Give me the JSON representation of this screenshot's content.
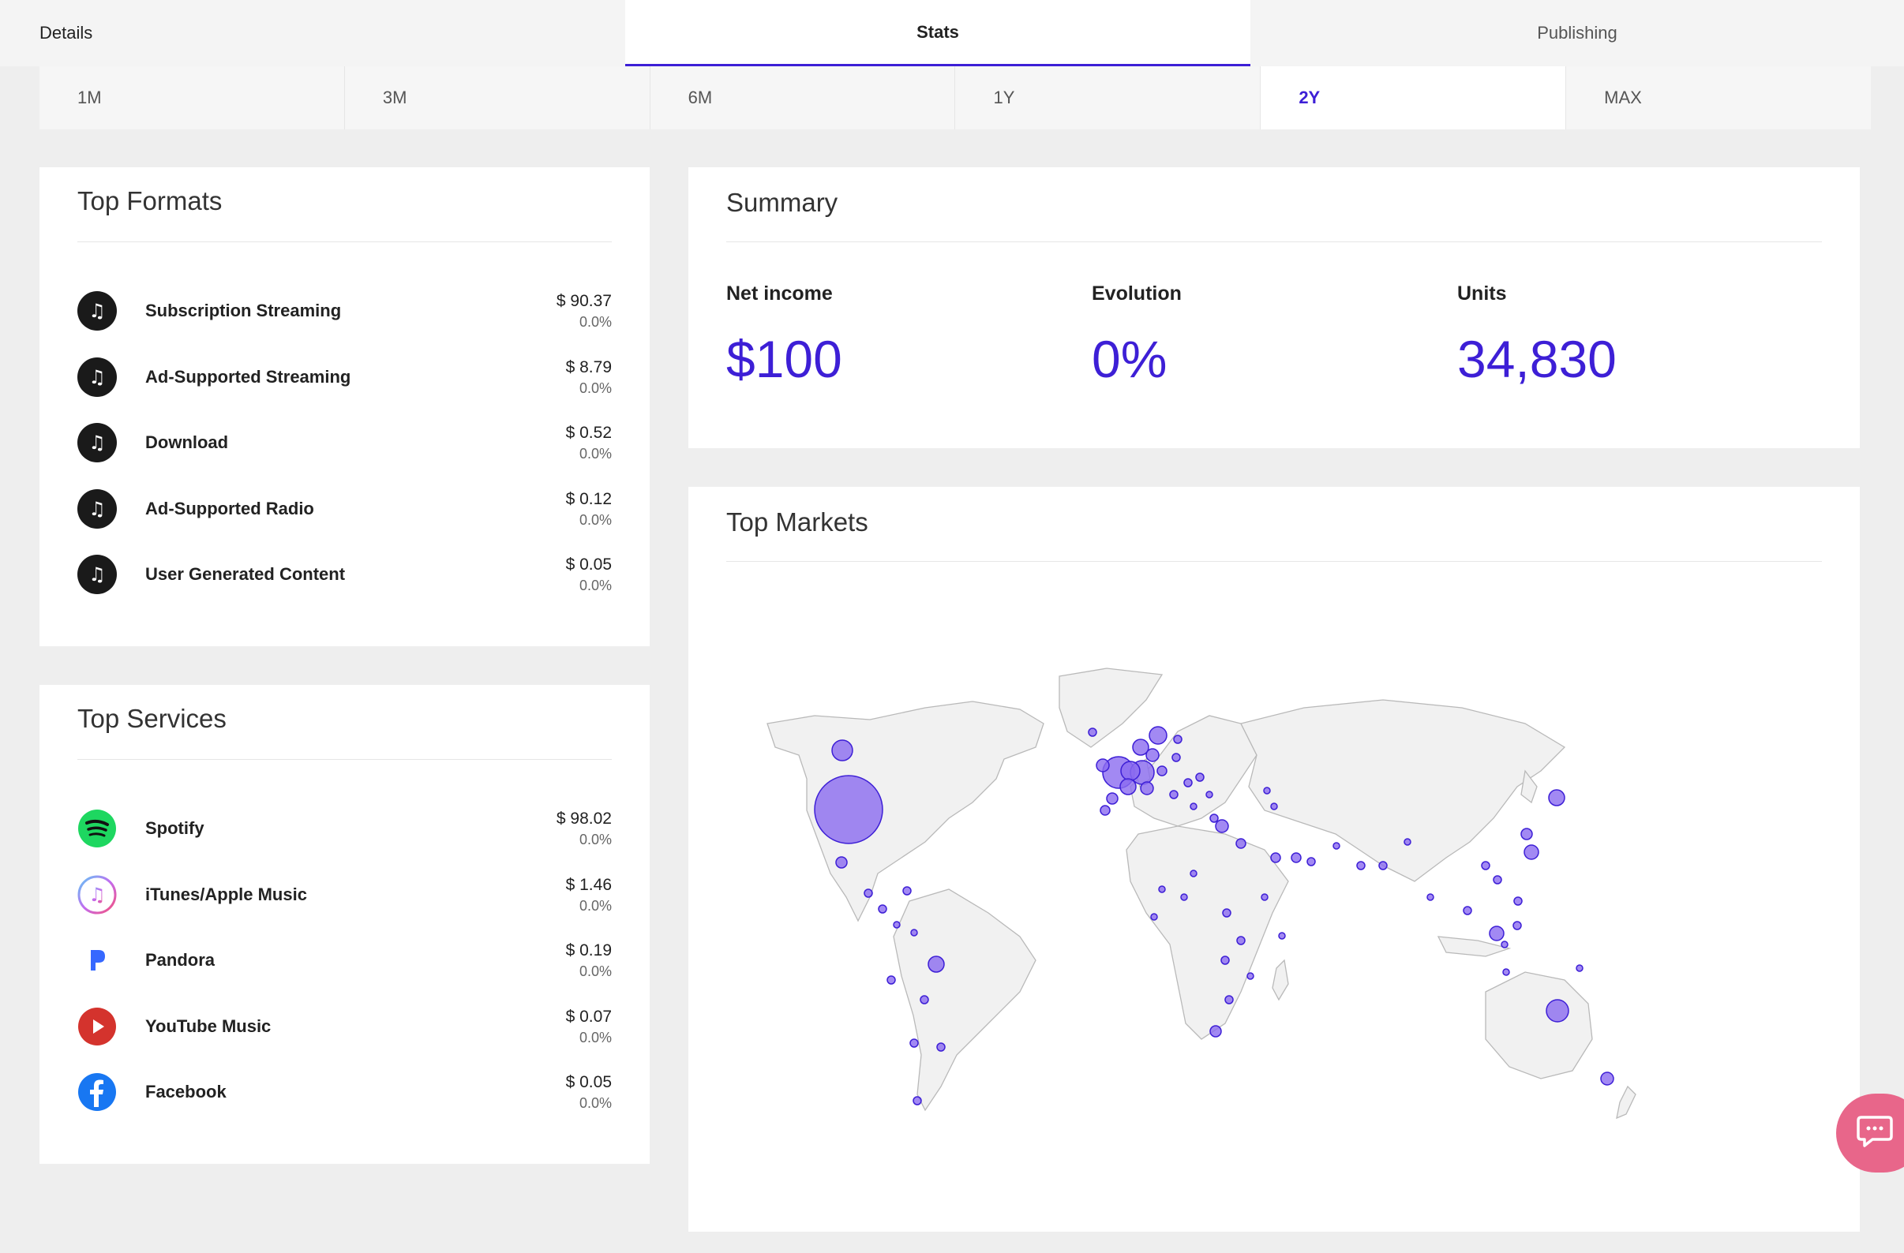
{
  "tabs": [
    {
      "label": "Details"
    },
    {
      "label": "Stats"
    },
    {
      "label": "Publishing"
    }
  ],
  "periods": [
    {
      "label": "1M"
    },
    {
      "label": "3M"
    },
    {
      "label": "6M"
    },
    {
      "label": "1Y"
    },
    {
      "label": "2Y"
    },
    {
      "label": "MAX"
    }
  ],
  "top_formats": {
    "title": "Top Formats",
    "items": [
      {
        "label": "Subscription Streaming",
        "amount": "$ 90.37",
        "pct": "0.0%",
        "icon": "music-note-icon"
      },
      {
        "label": "Ad-Supported Streaming",
        "amount": "$ 8.79",
        "pct": "0.0%",
        "icon": "music-note-icon"
      },
      {
        "label": "Download",
        "amount": "$ 0.52",
        "pct": "0.0%",
        "icon": "music-note-icon"
      },
      {
        "label": "Ad-Supported Radio",
        "amount": "$ 0.12",
        "pct": "0.0%",
        "icon": "music-note-icon"
      },
      {
        "label": "User Generated Content",
        "amount": "$ 0.05",
        "pct": "0.0%",
        "icon": "music-note-icon"
      }
    ]
  },
  "top_services": {
    "title": "Top Services",
    "items": [
      {
        "label": "Spotify",
        "amount": "$ 98.02",
        "pct": "0.0%",
        "icon": "spotify-icon"
      },
      {
        "label": "iTunes/Apple Music",
        "amount": "$ 1.46",
        "pct": "0.0%",
        "icon": "apple-music-icon"
      },
      {
        "label": "Pandora",
        "amount": "$ 0.19",
        "pct": "0.0%",
        "icon": "pandora-icon"
      },
      {
        "label": "YouTube Music",
        "amount": "$ 0.07",
        "pct": "0.0%",
        "icon": "youtube-music-icon"
      },
      {
        "label": "Facebook",
        "amount": "$ 0.05",
        "pct": "0.0%",
        "icon": "facebook-icon"
      }
    ]
  },
  "summary": {
    "title": "Summary",
    "net_income_label": "Net income",
    "net_income_value": "$100",
    "evolution_label": "Evolution",
    "evolution_value": "0%",
    "units_label": "Units",
    "units_value": "34,830"
  },
  "top_markets": {
    "title": "Top Markets"
  },
  "colors": {
    "accent": "#3d1fd6",
    "bubble_fill": "#8b6cf0",
    "bubble_stroke": "#3d1fd6",
    "land": "#f1f1f1",
    "spotify": "#1ed760",
    "youtube": "#d4332d",
    "facebook": "#1877f2",
    "chat": "#e8668a"
  }
}
